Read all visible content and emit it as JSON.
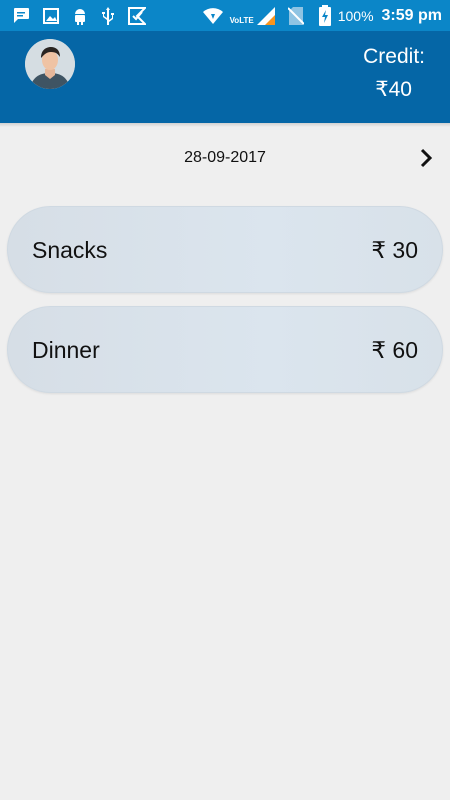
{
  "status_bar": {
    "left_icons": [
      "message-icon",
      "image-icon",
      "android-icon",
      "usb-icon",
      "app-notification-icon"
    ],
    "right_icons": [
      "wifi-icon",
      "signal-icon",
      "no-sim-icon",
      "battery-charging-icon"
    ],
    "volte": "VoLTE",
    "battery": "100%",
    "time": "3:59 pm"
  },
  "header": {
    "avatar_icon": "avatar",
    "credit_label": "Credit:",
    "credit_value": "₹40"
  },
  "date_row": {
    "date": "28-09-2017",
    "next_icon": "chevron-right-icon"
  },
  "items": [
    {
      "name": "Snacks",
      "price": "₹ 30"
    },
    {
      "name": "Dinner",
      "price": "₹ 60"
    }
  ],
  "colors": {
    "status_bar": "#0b86c8",
    "header": "#0566a6",
    "background": "#efefef",
    "item_background": "#dbe5ee"
  }
}
